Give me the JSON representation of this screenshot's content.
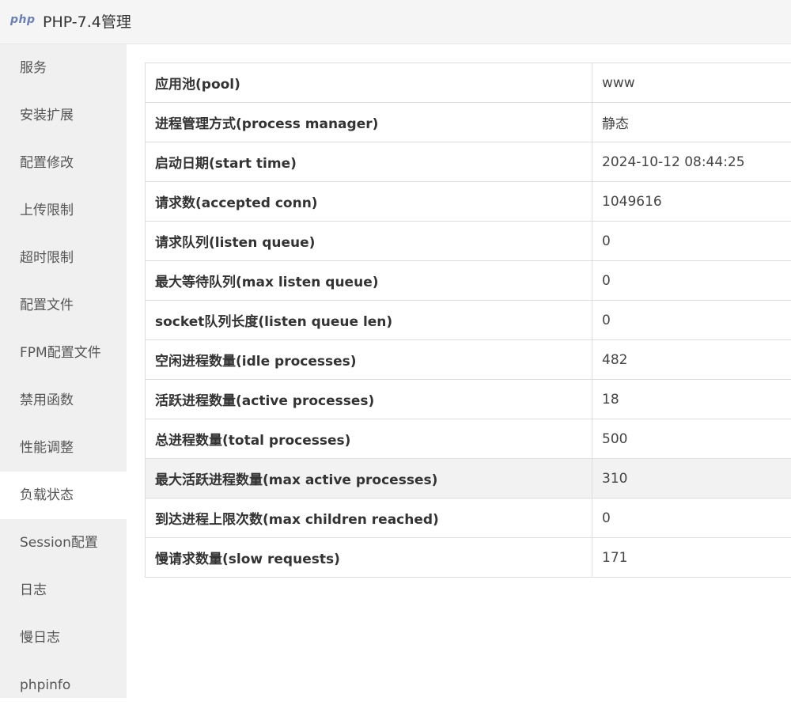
{
  "window": {
    "logo_text": "php",
    "title": "PHP-7.4管理"
  },
  "sidebar": {
    "items": [
      {
        "label": "服务",
        "id": "service"
      },
      {
        "label": "安装扩展",
        "id": "install-extensions"
      },
      {
        "label": "配置修改",
        "id": "config-edit"
      },
      {
        "label": "上传限制",
        "id": "upload-limit"
      },
      {
        "label": "超时限制",
        "id": "timeout-limit"
      },
      {
        "label": "配置文件",
        "id": "config-file"
      },
      {
        "label": "FPM配置文件",
        "id": "fpm-config-file"
      },
      {
        "label": "禁用函数",
        "id": "disabled-functions"
      },
      {
        "label": "性能调整",
        "id": "performance-tuning"
      },
      {
        "label": "负载状态",
        "id": "load-status"
      },
      {
        "label": "Session配置",
        "id": "session-config"
      },
      {
        "label": "日志",
        "id": "log"
      },
      {
        "label": "慢日志",
        "id": "slow-log"
      },
      {
        "label": "phpinfo",
        "id": "phpinfo"
      }
    ],
    "active_index": 9
  },
  "status_table": {
    "rows": [
      {
        "key": "应用池(pool)",
        "value": "www"
      },
      {
        "key": "进程管理方式(process manager)",
        "value": "静态"
      },
      {
        "key": "启动日期(start time)",
        "value": "2024-10-12 08:44:25"
      },
      {
        "key": "请求数(accepted conn)",
        "value": "1049616"
      },
      {
        "key": "请求队列(listen queue)",
        "value": "0"
      },
      {
        "key": "最大等待队列(max listen queue)",
        "value": "0"
      },
      {
        "key": "socket队列长度(listen queue len)",
        "value": "0"
      },
      {
        "key": "空闲进程数量(idle processes)",
        "value": "482"
      },
      {
        "key": "活跃进程数量(active processes)",
        "value": "18"
      },
      {
        "key": "总进程数量(total processes)",
        "value": "500"
      },
      {
        "key": "最大活跃进程数量(max active processes)",
        "value": "310"
      },
      {
        "key": "到达进程上限次数(max children reached)",
        "value": "0"
      },
      {
        "key": "慢请求数量(slow requests)",
        "value": "171"
      }
    ]
  }
}
